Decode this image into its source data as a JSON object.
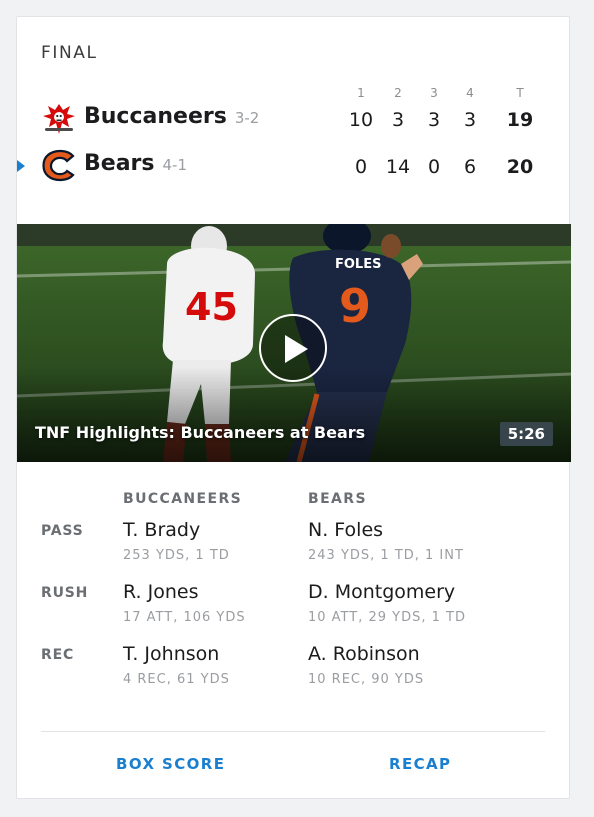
{
  "game": {
    "status": "FINAL",
    "quarter_headers": [
      "1",
      "2",
      "3",
      "4",
      "T"
    ],
    "teams": [
      {
        "name": "Buccaneers",
        "record": "3-2",
        "scores": [
          "10",
          "3",
          "3",
          "3"
        ],
        "total": "19",
        "winner": false
      },
      {
        "name": "Bears",
        "record": "4-1",
        "scores": [
          "0",
          "14",
          "0",
          "6"
        ],
        "total": "20",
        "winner": true
      }
    ]
  },
  "video": {
    "title": "TNF Highlights: Buccaneers at Bears",
    "duration": "5:26"
  },
  "leaders": {
    "teams": [
      "BUCCANEERS",
      "BEARS"
    ],
    "rows": [
      {
        "label": "PASS",
        "buccaneers": {
          "name": "T. Brady",
          "stats": "253 YDS, 1 TD"
        },
        "bears": {
          "name": "N. Foles",
          "stats": "243 YDS, 1 TD, 1 INT"
        }
      },
      {
        "label": "RUSH",
        "buccaneers": {
          "name": "R. Jones",
          "stats": "17 ATT, 106 YDS"
        },
        "bears": {
          "name": "D. Montgomery",
          "stats": "10 ATT, 29 YDS, 1 TD"
        }
      },
      {
        "label": "REC",
        "buccaneers": {
          "name": "T. Johnson",
          "stats": "4 REC, 61 YDS"
        },
        "bears": {
          "name": "A. Robinson",
          "stats": "10 REC, 90 YDS"
        }
      }
    ]
  },
  "actions": {
    "box_score": "BOX SCORE",
    "recap": "RECAP"
  },
  "colors": {
    "accent": "#1a7fcf",
    "buccaneers_red": "#d50a0a",
    "bears_orange": "#e35a1c",
    "bears_navy": "#0b162a"
  },
  "icons": {
    "buccaneers_logo": "buccaneers-logo-icon",
    "bears_logo": "bears-logo-icon",
    "play": "play-icon",
    "winner_indicator": "winner-arrow-icon"
  }
}
